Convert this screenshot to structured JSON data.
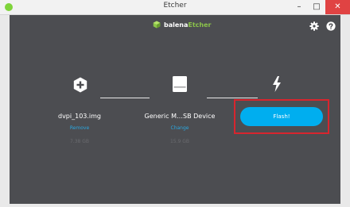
{
  "window": {
    "title": "Etcher",
    "minimize_glyph": "–",
    "maximize_glyph": "□",
    "close_glyph": "✕"
  },
  "header": {
    "logo_prefix": "balena",
    "logo_accent": "Etcher",
    "icons": [
      "settings-gear-icon",
      "help-icon"
    ]
  },
  "steps": {
    "image": {
      "icon": "plus-hexagon-icon",
      "title": "dvpi_103.img",
      "action": "Remove",
      "size": "7.38 GB"
    },
    "drive": {
      "icon": "drive-icon",
      "title": "Generic M…SB Device",
      "action": "Change",
      "size": "15.9 GB"
    },
    "flash": {
      "icon": "lightning-bolt-icon",
      "button_label": "Flash!"
    }
  },
  "colors": {
    "titlebar": "#f2f2f2",
    "app_background": "#4c4d51",
    "accent_blue": "#00aeef",
    "link_blue": "#2aa7e0",
    "logo_green": "#8bc34a",
    "highlight_red": "#d8252e",
    "close_red": "#e04343"
  }
}
